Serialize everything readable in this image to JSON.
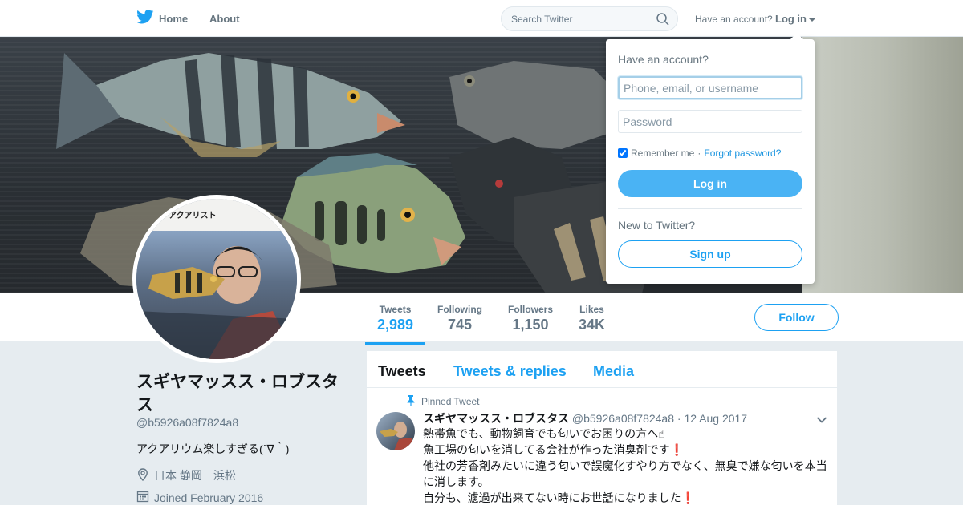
{
  "nav": {
    "home_label": "Home",
    "about_label": "About",
    "search_placeholder": "Search Twitter",
    "have_account": "Have an account?",
    "login_label": "Log in"
  },
  "profile": {
    "name": "スギヤマッスス・ロブスタス",
    "handle": "@b5926a08f7824a8",
    "bio": "アクアリウム楽しすぎる(´∇｀)",
    "location": "日本 静岡　浜松",
    "joined": "Joined February 2016",
    "avatar_sign": "アクアリスト"
  },
  "stats": [
    {
      "label": "Tweets",
      "value": "2,989"
    },
    {
      "label": "Following",
      "value": "745"
    },
    {
      "label": "Followers",
      "value": "1,150"
    },
    {
      "label": "Likes",
      "value": "34K"
    }
  ],
  "follow_label": "Follow",
  "timeline": {
    "tabs": [
      "Tweets",
      "Tweets & replies",
      "Media"
    ],
    "pinned_label": "Pinned Tweet",
    "tweet": {
      "name": "スギヤマッスス・ロブスタス",
      "handle": "@b5926a08f7824a8",
      "sep": "·",
      "date": "12 Aug 2017",
      "lines": [
        "熱帯魚でも、動物飼育でも匂いでお困りの方へ☝",
        "魚工場の匂いを消してる会社が作った消臭剤です",
        "他社の芳香剤みたいに違う匂いで誤魔化すやり方でなく、無臭で嫌な匂いを本当に消します。",
        "自分も、濾過が出来てない時にお世話になりました"
      ],
      "exclamation": "❗"
    }
  },
  "login_dropdown": {
    "title": "Have an account?",
    "username_placeholder": "Phone, email, or username",
    "password_placeholder": "Password",
    "remember": "Remember me",
    "dot": "·",
    "forgot": "Forgot password?",
    "login_button": "Log in",
    "new_prompt": "New to Twitter?",
    "signup_button": "Sign up"
  },
  "colors": {
    "accent": "#1da1f2",
    "login_button": "#4ab3f4",
    "alert": "#d0021b"
  }
}
